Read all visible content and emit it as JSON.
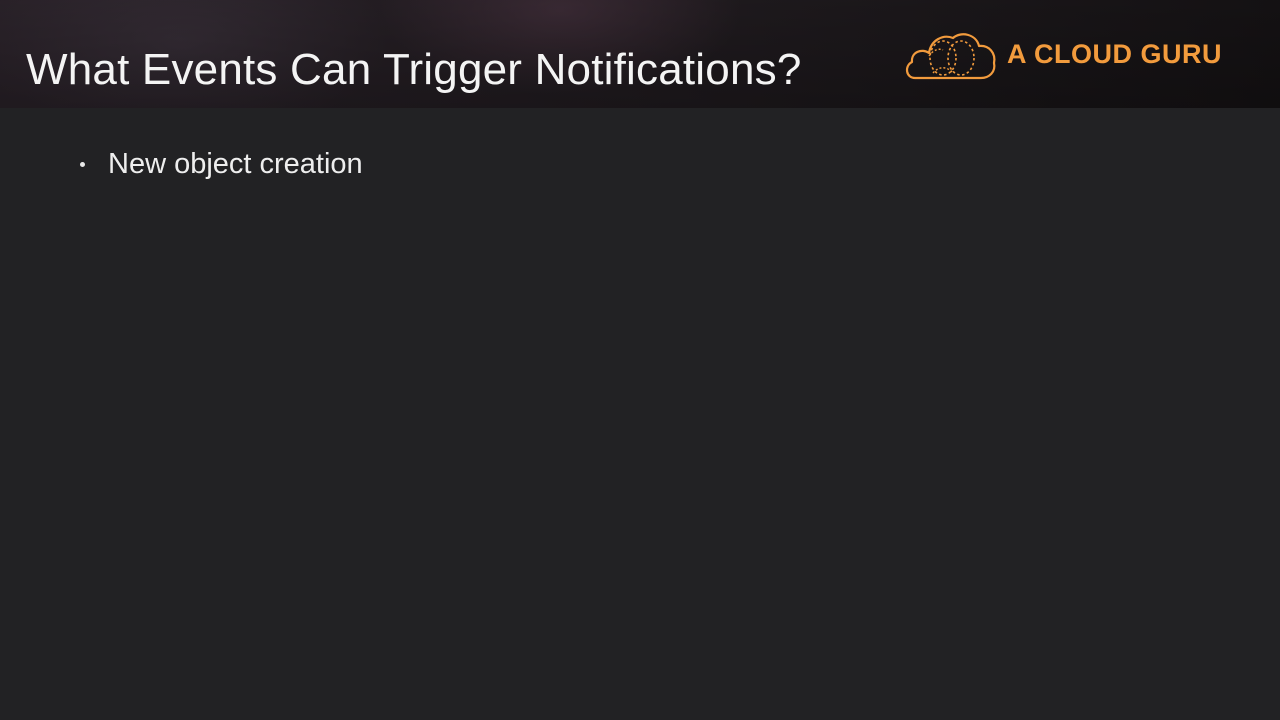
{
  "slide": {
    "title": "What Events Can Trigger Notifications?",
    "bullets": [
      "New object creation"
    ]
  },
  "logo": {
    "text": "A CLOUD GURU",
    "icon": "cloud-icon",
    "color": "#f29b3d"
  },
  "colors": {
    "background": "#222224",
    "title_text": "#f4f4f4",
    "body_text": "#eeeeee",
    "accent": "#f29b3d"
  }
}
